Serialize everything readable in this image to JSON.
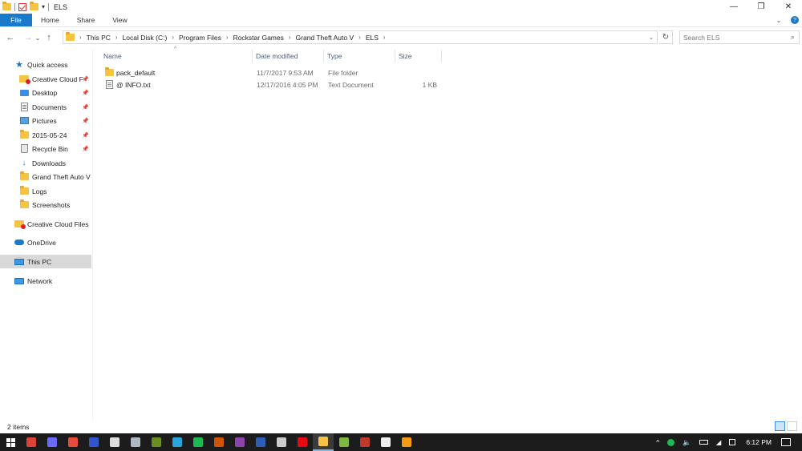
{
  "window": {
    "title": "ELS",
    "controls": {
      "minimize": "—",
      "maximize": "❐",
      "close": "✕"
    }
  },
  "ribbon": {
    "tabs": [
      "File",
      "Home",
      "Share",
      "View"
    ],
    "expand": "⌄",
    "help": "?"
  },
  "nav": {
    "back": "←",
    "forward": "→",
    "recent": "⌄",
    "up": "↑",
    "breadcrumb": [
      "This PC",
      "Local Disk (C:)",
      "Program Files",
      "Rockstar Games",
      "Grand Theft Auto V",
      "ELS"
    ],
    "search_placeholder": "Search ELS"
  },
  "sidebar": {
    "quick_access": "Quick access",
    "items": [
      {
        "label": "Creative Cloud F",
        "icon": "creative-cloud-folder-icon",
        "pinned": true
      },
      {
        "label": "Desktop",
        "icon": "desktop-icon",
        "pinned": true
      },
      {
        "label": "Documents",
        "icon": "documents-icon",
        "pinned": true
      },
      {
        "label": "Pictures",
        "icon": "pictures-icon",
        "pinned": true
      },
      {
        "label": "2015-05-24",
        "icon": "folder-icon",
        "pinned": true
      },
      {
        "label": "Recycle Bin",
        "icon": "recycle-bin-icon",
        "pinned": true
      },
      {
        "label": "Downloads",
        "icon": "downloads-icon",
        "pinned": false
      },
      {
        "label": "Grand Theft Auto V",
        "icon": "folder-icon",
        "pinned": false
      },
      {
        "label": "Logs",
        "icon": "folder-icon",
        "pinned": false
      },
      {
        "label": "Screenshots",
        "icon": "folder-icon",
        "pinned": false
      }
    ],
    "creative_cloud": "Creative Cloud Files",
    "onedrive": "OneDrive",
    "this_pc": "This PC",
    "network": "Network"
  },
  "files": {
    "columns": [
      "Name",
      "Date modified",
      "Type",
      "Size"
    ],
    "rows": [
      {
        "name": "pack_default",
        "date": "11/7/2017 9:53 AM",
        "type": "File folder",
        "size": "",
        "icon": "folder-icon"
      },
      {
        "name": "@ INFO.txt",
        "date": "12/17/2016 4:05 PM",
        "type": "Text Document",
        "size": "1 KB",
        "icon": "text-file-icon"
      }
    ]
  },
  "status": {
    "item_count": "2 items"
  },
  "taskbar": {
    "apps": [
      {
        "name": "chrome-icon",
        "color": "#db4437"
      },
      {
        "name": "app-icon-2",
        "color": "#6a6aff"
      },
      {
        "name": "app-icon-3",
        "color": "#e74c3c"
      },
      {
        "name": "app-icon-4",
        "color": "#3355cc"
      },
      {
        "name": "app-icon-5",
        "color": "#dddddd"
      },
      {
        "name": "steam-icon",
        "color": "#b0b8c4"
      },
      {
        "name": "minecraft-icon",
        "color": "#6b8e23"
      },
      {
        "name": "app-icon-8",
        "color": "#2aa5d8"
      },
      {
        "name": "spotify-icon",
        "color": "#1db954"
      },
      {
        "name": "app-icon-10",
        "color": "#d35400"
      },
      {
        "name": "app-icon-11",
        "color": "#8e44ad"
      },
      {
        "name": "app-icon-12",
        "color": "#2e5fb8"
      },
      {
        "name": "app-icon-13",
        "color": "#cccccc"
      },
      {
        "name": "netflix-icon",
        "color": "#e50914"
      },
      {
        "name": "file-explorer-icon",
        "color": "#f6c343"
      },
      {
        "name": "gta-icon",
        "color": "#7fb83e"
      },
      {
        "name": "app-icon-17",
        "color": "#c0392b"
      },
      {
        "name": "app-icon-18",
        "color": "#eeeeee"
      },
      {
        "name": "app-icon-19",
        "color": "#f39c12"
      }
    ],
    "tray": {
      "chevron": "^",
      "clock": "6:12 PM"
    }
  },
  "colors": {
    "accent": "#1979ca",
    "selected": "#d9d9d9",
    "header_text": "#4c607a"
  }
}
